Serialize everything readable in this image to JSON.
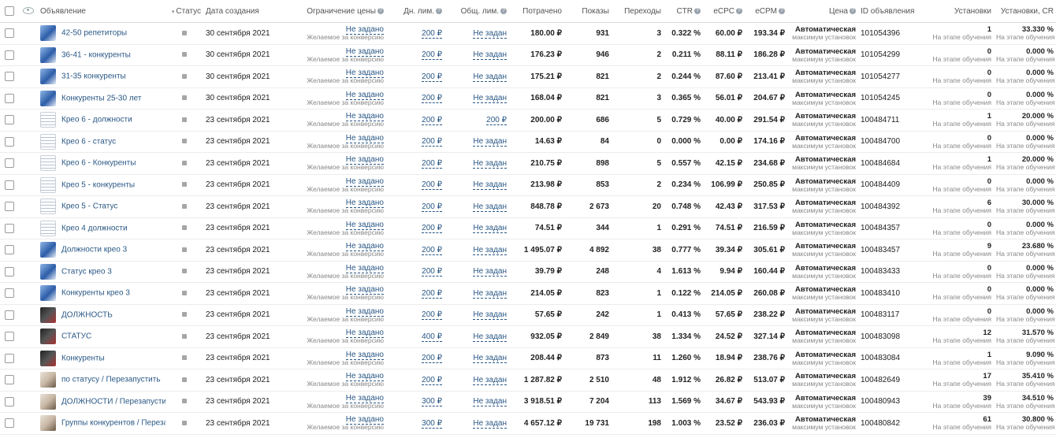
{
  "headers": {
    "ad": "Объявление",
    "status": "Статус",
    "created": "Дата создания",
    "price_limit": "Ограничение цены",
    "daily_limit": "Дн. лим.",
    "total_limit": "Общ. лим.",
    "spent": "Потрачено",
    "impressions": "Показы",
    "clicks": "Переходы",
    "ctr": "CTR",
    "ecpc": "eCPC",
    "ecpm": "eCPM",
    "price": "Цена",
    "ad_id": "ID объявления",
    "installs": "Установки",
    "installs_cr": "Установки, CR"
  },
  "common": {
    "price_limit_value": "Не задано",
    "price_limit_sub": "Желаемое за конверсию",
    "price_main": "Автоматическая",
    "price_sub": "максимум установок",
    "learning": "На этапе обучения"
  },
  "rows": [
    {
      "thumb": "blue",
      "name": "42-50 репетиторы",
      "date": "30 сентября 2021",
      "daily": "200 ₽",
      "total": "Не задан",
      "spent": "180.00 ₽",
      "impr": "931",
      "clicks": "3",
      "ctr": "0.322 %",
      "ecpc": "60.00 ₽",
      "ecpm": "193.34 ₽",
      "id": "101054396",
      "inst": "1",
      "cr": "33.330 %"
    },
    {
      "thumb": "blue",
      "name": "36-41 - конкуренты",
      "date": "30 сентября 2021",
      "daily": "200 ₽",
      "total": "Не задан",
      "spent": "176.23 ₽",
      "impr": "946",
      "clicks": "2",
      "ctr": "0.211 %",
      "ecpc": "88.11 ₽",
      "ecpm": "186.28 ₽",
      "id": "101054299",
      "inst": "0",
      "cr": "0.000 %"
    },
    {
      "thumb": "blue",
      "name": "31-35 конкуренты",
      "date": "30 сентября 2021",
      "daily": "200 ₽",
      "total": "Не задан",
      "spent": "175.21 ₽",
      "impr": "821",
      "clicks": "2",
      "ctr": "0.244 %",
      "ecpc": "87.60 ₽",
      "ecpm": "213.41 ₽",
      "id": "101054277",
      "inst": "0",
      "cr": "0.000 %"
    },
    {
      "thumb": "blue",
      "name": "Конкуренты 25-30 лет",
      "date": "30 сентября 2021",
      "daily": "200 ₽",
      "total": "Не задан",
      "spent": "168.04 ₽",
      "impr": "821",
      "clicks": "3",
      "ctr": "0.365 %",
      "ecpc": "56.01 ₽",
      "ecpm": "204.67 ₽",
      "id": "101054245",
      "inst": "0",
      "cr": "0.000 %"
    },
    {
      "thumb": "doc",
      "name": "Крео 6 - должности",
      "date": "23 сентября 2021",
      "daily": "200 ₽",
      "total": "200 ₽",
      "spent": "200.00 ₽",
      "impr": "686",
      "clicks": "5",
      "ctr": "0.729 %",
      "ecpc": "40.00 ₽",
      "ecpm": "291.54 ₽",
      "id": "100484711",
      "inst": "1",
      "cr": "20.000 %"
    },
    {
      "thumb": "doc",
      "name": "Крео 6 - статус",
      "date": "23 сентября 2021",
      "daily": "200 ₽",
      "total": "Не задан",
      "spent": "14.63 ₽",
      "impr": "84",
      "clicks": "0",
      "ctr": "0.000 %",
      "ecpc": "0.00 ₽",
      "ecpm": "174.16 ₽",
      "id": "100484700",
      "inst": "0",
      "cr": "0.000 %"
    },
    {
      "thumb": "doc",
      "name": "Крео 6 - Конкуренты",
      "date": "23 сентября 2021",
      "daily": "200 ₽",
      "total": "Не задан",
      "spent": "210.75 ₽",
      "impr": "898",
      "clicks": "5",
      "ctr": "0.557 %",
      "ecpc": "42.15 ₽",
      "ecpm": "234.68 ₽",
      "id": "100484684",
      "inst": "1",
      "cr": "20.000 %"
    },
    {
      "thumb": "doc",
      "name": "Крео 5 - конкуренты",
      "date": "23 сентября 2021",
      "daily": "200 ₽",
      "total": "Не задан",
      "spent": "213.98 ₽",
      "impr": "853",
      "clicks": "2",
      "ctr": "0.234 %",
      "ecpc": "106.99 ₽",
      "ecpm": "250.85 ₽",
      "id": "100484409",
      "inst": "0",
      "cr": "0.000 %"
    },
    {
      "thumb": "doc",
      "name": "Крео 5 - Статус",
      "date": "23 сентября 2021",
      "daily": "200 ₽",
      "total": "Не задан",
      "spent": "848.78 ₽",
      "impr": "2 673",
      "clicks": "20",
      "ctr": "0.748 %",
      "ecpc": "42.43 ₽",
      "ecpm": "317.53 ₽",
      "id": "100484392",
      "inst": "6",
      "cr": "30.000 %"
    },
    {
      "thumb": "doc",
      "name": "Крео 4 должности",
      "date": "23 сентября 2021",
      "daily": "200 ₽",
      "total": "Не задан",
      "spent": "74.51 ₽",
      "impr": "344",
      "clicks": "1",
      "ctr": "0.291 %",
      "ecpc": "74.51 ₽",
      "ecpm": "216.59 ₽",
      "id": "100484357",
      "inst": "0",
      "cr": "0.000 %"
    },
    {
      "thumb": "blue",
      "name": "Должности крео 3",
      "date": "23 сентября 2021",
      "daily": "200 ₽",
      "total": "Не задан",
      "spent": "1 495.07 ₽",
      "impr": "4 892",
      "clicks": "38",
      "ctr": "0.777 %",
      "ecpc": "39.34 ₽",
      "ecpm": "305.61 ₽",
      "id": "100483457",
      "inst": "9",
      "cr": "23.680 %"
    },
    {
      "thumb": "blue",
      "name": "Статус крео 3",
      "date": "23 сентября 2021",
      "daily": "200 ₽",
      "total": "Не задан",
      "spent": "39.79 ₽",
      "impr": "248",
      "clicks": "4",
      "ctr": "1.613 %",
      "ecpc": "9.94 ₽",
      "ecpm": "160.44 ₽",
      "id": "100483433",
      "inst": "0",
      "cr": "0.000 %"
    },
    {
      "thumb": "blue",
      "name": "Конкуренты крео 3",
      "date": "23 сентября 2021",
      "daily": "200 ₽",
      "total": "Не задан",
      "spent": "214.05 ₽",
      "impr": "823",
      "clicks": "1",
      "ctr": "0.122 %",
      "ecpc": "214.05 ₽",
      "ecpm": "260.08 ₽",
      "id": "100483410",
      "inst": "0",
      "cr": "0.000 %"
    },
    {
      "thumb": "dark",
      "name": "ДОЛЖНОСТЬ",
      "date": "23 сентября 2021",
      "daily": "200 ₽",
      "total": "Не задан",
      "spent": "57.65 ₽",
      "impr": "242",
      "clicks": "1",
      "ctr": "0.413 %",
      "ecpc": "57.65 ₽",
      "ecpm": "238.22 ₽",
      "id": "100483117",
      "inst": "0",
      "cr": "0.000 %"
    },
    {
      "thumb": "dark",
      "name": "СТАТУС",
      "date": "23 сентября 2021",
      "daily": "400 ₽",
      "total": "Не задан",
      "spent": "932.05 ₽",
      "impr": "2 849",
      "clicks": "38",
      "ctr": "1.334 %",
      "ecpc": "24.52 ₽",
      "ecpm": "327.14 ₽",
      "id": "100483098",
      "inst": "12",
      "cr": "31.570 %"
    },
    {
      "thumb": "dark",
      "name": "Конкуренты",
      "date": "23 сентября 2021",
      "daily": "200 ₽",
      "total": "Не задан",
      "spent": "208.44 ₽",
      "impr": "873",
      "clicks": "11",
      "ctr": "1.260 %",
      "ecpc": "18.94 ₽",
      "ecpm": "238.76 ₽",
      "id": "100483084",
      "inst": "1",
      "cr": "9.090 %"
    },
    {
      "thumb": "light",
      "name": "по статусу / Перезапустить",
      "date": "23 сентября 2021",
      "daily": "200 ₽",
      "total": "Не задан",
      "spent": "1 287.82 ₽",
      "impr": "2 510",
      "clicks": "48",
      "ctr": "1.912 %",
      "ecpc": "26.82 ₽",
      "ecpm": "513.07 ₽",
      "id": "100482649",
      "inst": "17",
      "cr": "35.410 %"
    },
    {
      "thumb": "light",
      "name": "ДОЛЖНОСТИ / Перезапустить",
      "date": "23 сентября 2021",
      "daily": "300 ₽",
      "total": "Не задан",
      "spent": "3 918.51 ₽",
      "impr": "7 204",
      "clicks": "113",
      "ctr": "1.569 %",
      "ecpc": "34.67 ₽",
      "ecpm": "543.93 ₽",
      "id": "100480943",
      "inst": "39",
      "cr": "34.510 %"
    },
    {
      "thumb": "light",
      "name": "Группы конкурентов / Перезапус...",
      "date": "23 сентября 2021",
      "daily": "300 ₽",
      "total": "Не задан",
      "spent": "4 657.12 ₽",
      "impr": "19 731",
      "clicks": "198",
      "ctr": "1.003 %",
      "ecpc": "23.52 ₽",
      "ecpm": "236.03 ₽",
      "id": "100480842",
      "inst": "61",
      "cr": "30.800 %"
    }
  ]
}
